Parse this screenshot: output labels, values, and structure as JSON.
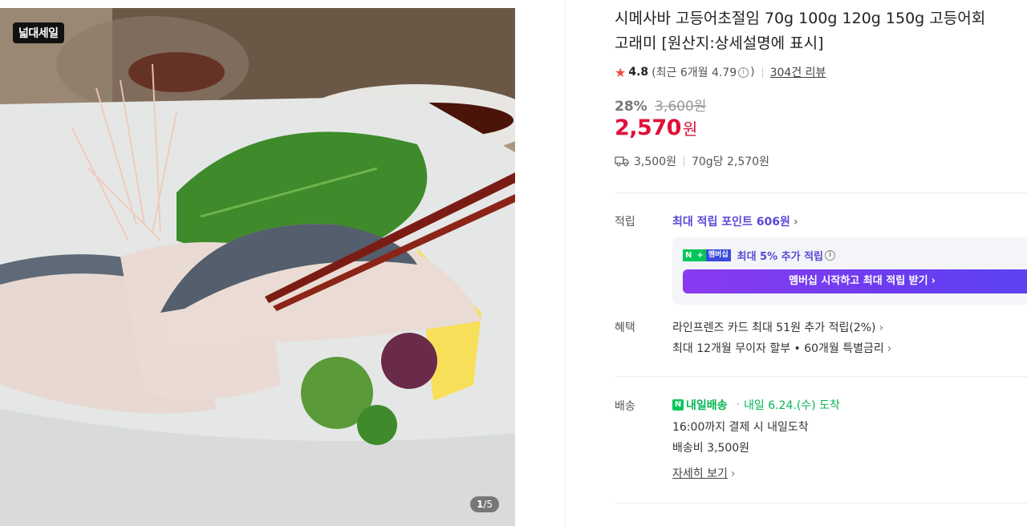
{
  "gallery": {
    "badge": "넓대세일",
    "counter_current": "1",
    "counter_total": "/5"
  },
  "product": {
    "title_line1": "시메사바 고등어초절임 70g 100g 120g 150g 고등어회",
    "title_line2": "고래미 [원산지:상세설명에 표시]",
    "rating": "4.8",
    "recent_rating": "(최근 6개월 4.79",
    "recent_rating_close": ")",
    "info_glyph": "i",
    "reviews": "304건 리뷰",
    "discount": "28%",
    "original_price": "3,600원",
    "price": "2,570",
    "price_unit": "원",
    "shipping_fee": "3,500원",
    "unit_price": "70g당 2,570원"
  },
  "points": {
    "label": "적립",
    "max_points": "최대 적립 포인트 606원",
    "membership_logo_n": "N",
    "membership_logo_plus": "+",
    "membership_logo_text": "멤버십",
    "membership_extra": "최대 5% 추가 적립",
    "membership_button": "멤버십 시작하고 최대 적립 받기"
  },
  "benefits": {
    "label": "혜택",
    "card": "라인프렌즈 카드 최대 51원 추가 적립(2%)",
    "installment": "최대 12개월 무이자 할부 • 60개월 특별금리"
  },
  "delivery": {
    "label": "배송",
    "badge_n": "N",
    "badge_text": "내일배송",
    "dot": "·",
    "arrival": "내일 6.24.(수) 도착",
    "cutoff": "16:00까지 결제 시 내일도착",
    "fee": "배송비 3,500원",
    "detail_link": "자세히 보기"
  },
  "colors": {
    "price_red": "#e0103a",
    "point_purple": "#5a48d6",
    "naver_green": "#03c75a"
  }
}
